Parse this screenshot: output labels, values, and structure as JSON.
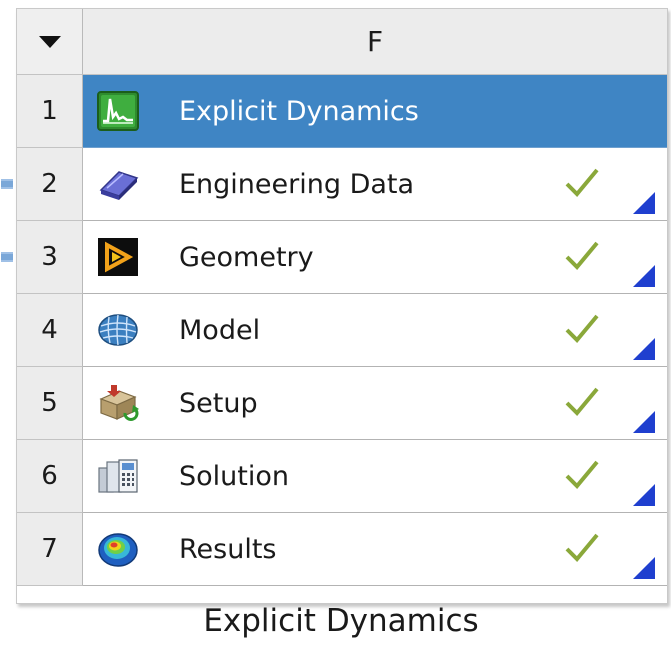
{
  "system": {
    "column_letter": "F",
    "header_dropdown_icon": "dropdown-arrow-icon",
    "title_row": {
      "number": "1",
      "label": "Explicit Dynamics",
      "icon": "explicit-dynamics-icon",
      "highlight_color": "#3f85c4"
    },
    "cells": [
      {
        "number": "2",
        "label": "Engineering Data",
        "icon": "engineering-data-icon",
        "status": "check-icon"
      },
      {
        "number": "3",
        "label": "Geometry",
        "icon": "geometry-icon",
        "status": "check-icon"
      },
      {
        "number": "4",
        "label": "Model",
        "icon": "model-icon",
        "status": "check-icon"
      },
      {
        "number": "5",
        "label": "Setup",
        "icon": "setup-icon",
        "status": "check-icon"
      },
      {
        "number": "6",
        "label": "Solution",
        "icon": "solution-icon",
        "status": "check-icon"
      },
      {
        "number": "7",
        "label": "Results",
        "icon": "results-icon",
        "status": "check-icon"
      }
    ],
    "caption": "Explicit Dynamics"
  }
}
